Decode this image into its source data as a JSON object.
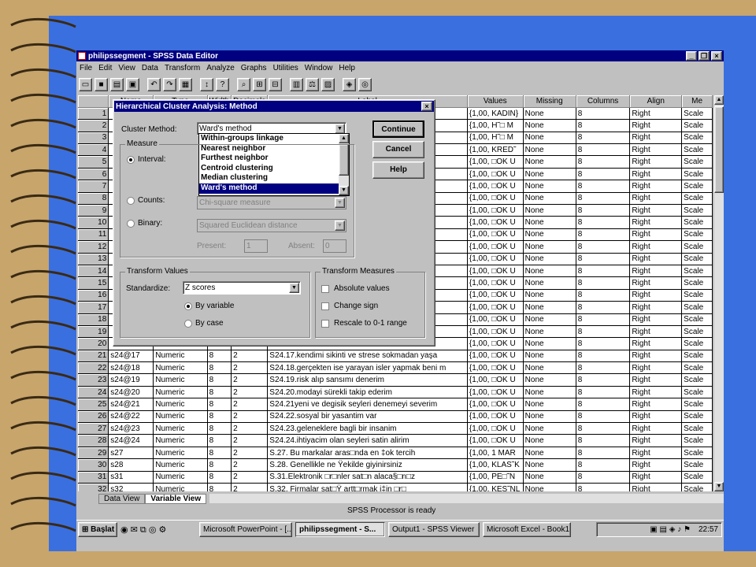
{
  "window": {
    "title": "philipssegment - SPSS Data Editor",
    "menu": [
      "File",
      "Edit",
      "View",
      "Data",
      "Transform",
      "Analyze",
      "Graphs",
      "Utilities",
      "Window",
      "Help"
    ],
    "controls": [
      "_",
      "❐",
      "×"
    ]
  },
  "grid": {
    "columns": [
      "",
      "Name",
      "Type",
      "Width",
      "Decimals",
      "Label",
      "Values",
      "Missing",
      "Columns",
      "Align",
      "Me"
    ],
    "rows": [
      [
        "1",
        "",
        "",
        "",
        "",
        "",
        "{1,00, KADIN}",
        "None",
        "8",
        "Right",
        "Scale"
      ],
      [
        "2",
        "",
        "",
        "",
        "",
        "",
        "{1,00, H˜□ M",
        "None",
        "8",
        "Right",
        "Scale"
      ],
      [
        "3",
        "",
        "",
        "",
        "",
        "",
        "{1,00, H˜□ M",
        "None",
        "8",
        "Right",
        "Scale"
      ],
      [
        "4",
        "",
        "",
        "",
        "",
        "",
        "{1,00, KRED˜",
        "None",
        "8",
        "Right",
        "Scale"
      ],
      [
        "5",
        "",
        "",
        "",
        "",
        "rebil",
        "{1,00, □OK U",
        "None",
        "8",
        "Right",
        "Scale"
      ],
      [
        "6",
        "",
        "",
        "",
        "",
        "",
        "{1,00, □OK U",
        "None",
        "8",
        "Right",
        "Scale"
      ],
      [
        "7",
        "",
        "",
        "",
        "",
        "öne",
        "{1,00, □OK U",
        "None",
        "8",
        "Right",
        "Scale"
      ],
      [
        "8",
        "",
        "",
        "",
        "",
        "",
        "{1,00, □OK U",
        "None",
        "8",
        "Right",
        "Scale"
      ],
      [
        "9",
        "",
        "",
        "",
        "",
        "n",
        "{1,00, □OK U",
        "None",
        "8",
        "Right",
        "Scale"
      ],
      [
        "10",
        "",
        "",
        "",
        "",
        "um",
        "{1,00, □OK U",
        "None",
        "8",
        "Right",
        "Scale"
      ],
      [
        "11",
        "",
        "",
        "",
        "",
        "mel",
        "{1,00, □OK U",
        "None",
        "8",
        "Right",
        "Scale"
      ],
      [
        "12",
        "",
        "",
        "",
        "",
        "n alır",
        "{1,00, □OK U",
        "None",
        "8",
        "Right",
        "Scale"
      ],
      [
        "13",
        "",
        "",
        "",
        "",
        "tirdi",
        "{1,00, □OK U",
        "None",
        "8",
        "Right",
        "Scale"
      ],
      [
        "14",
        "",
        "",
        "",
        "",
        "arm",
        "{1,00, □OK U",
        "None",
        "8",
        "Right",
        "Scale"
      ],
      [
        "15",
        "",
        "",
        "",
        "",
        "edi",
        "{1,00, □OK U",
        "None",
        "8",
        "Right",
        "Scale"
      ],
      [
        "16",
        "",
        "",
        "",
        "",
        "erci",
        "{1,00, □OK U",
        "None",
        "8",
        "Right",
        "Scale"
      ],
      [
        "17",
        "",
        "",
        "",
        "",
        "mak",
        "{1,00, □OK U",
        "None",
        "8",
        "Right",
        "Scale"
      ],
      [
        "18",
        "",
        "",
        "",
        "",
        "",
        "{1,00, □OK U",
        "None",
        "8",
        "Right",
        "Scale"
      ],
      [
        "19",
        "",
        "",
        "",
        "",
        "al b",
        "{1,00, □OK U",
        "None",
        "8",
        "Right",
        "Scale"
      ],
      [
        "20",
        "",
        "",
        "",
        "",
        "",
        "{1,00, □OK U",
        "None",
        "8",
        "Right",
        "Scale"
      ],
      [
        "21",
        "s24@17",
        "Numeric",
        "8",
        "2",
        "S24.17.kendimi sikinti ve strese sokmadan yaşa",
        "{1,00, □OK U",
        "None",
        "8",
        "Right",
        "Scale"
      ],
      [
        "22",
        "s24@18",
        "Numeric",
        "8",
        "2",
        "S24.18.gerçekten ise yarayan isler yapmak beni m",
        "{1,00, □OK U",
        "None",
        "8",
        "Right",
        "Scale"
      ],
      [
        "23",
        "s24@19",
        "Numeric",
        "8",
        "2",
        "S24.19.risk alıp sansımı denerim",
        "{1,00, □OK U",
        "None",
        "8",
        "Right",
        "Scale"
      ],
      [
        "24",
        "s24@20",
        "Numeric",
        "8",
        "2",
        "S24.20.modayi sürekli takip ederim",
        "{1,00, □OK U",
        "None",
        "8",
        "Right",
        "Scale"
      ],
      [
        "25",
        "s24@21",
        "Numeric",
        "8",
        "2",
        "S24.21yeni ve degisik seyleri denemeyi severim",
        "{1,00, □OK U",
        "None",
        "8",
        "Right",
        "Scale"
      ],
      [
        "26",
        "s24@22",
        "Numeric",
        "8",
        "2",
        "S24.22.sosyal bir yasantim var",
        "{1,00, □OK U",
        "None",
        "8",
        "Right",
        "Scale"
      ],
      [
        "27",
        "s24@23",
        "Numeric",
        "8",
        "2",
        "S24.23.geleneklere bagli bir insanim",
        "{1,00, □OK U",
        "None",
        "8",
        "Right",
        "Scale"
      ],
      [
        "28",
        "s24@24",
        "Numeric",
        "8",
        "2",
        "S24.24.ihtiyacim olan seyleri satin alirim",
        "{1,00, □OK U",
        "None",
        "8",
        "Right",
        "Scale"
      ],
      [
        "29",
        "s27",
        "Numeric",
        "8",
        "2",
        "S.27. Bu markalar aras□nda en ‡ok tercih",
        "{1,00, 1 MAR",
        "None",
        "8",
        "Right",
        "Scale"
      ],
      [
        "30",
        "s28",
        "Numeric",
        "8",
        "2",
        "S.28. Genellikle ne Ÿekilde giyinirsiniz",
        "{1,00, KLAS˜K",
        "None",
        "8",
        "Right",
        "Scale"
      ],
      [
        "31",
        "s31",
        "Numeric",
        "8",
        "2",
        "S.31.Elektronik □r□nler sat□n alaca§□n□z",
        "{1,00, PE□˜N",
        "None",
        "8",
        "Right",
        "Scale"
      ],
      [
        "32",
        "s32",
        "Numeric",
        "8",
        "2",
        "S.32. Firmalar sat□Ÿ artt□rmak i‡in  □r□",
        "{1,00, KES˜NL",
        "None",
        "8",
        "Right",
        "Scale"
      ]
    ]
  },
  "tabs": [
    "Data View",
    "Variable View"
  ],
  "status": "SPSS Processor  is ready",
  "taskbar": {
    "start": "Başlat",
    "tasks": [
      "Microsoft PowerPoint - [...",
      "philipssegment - S...",
      "Output1 - SPSS Viewer",
      "Microsoft Excel - Book1"
    ],
    "clock": "22:57"
  },
  "dialog": {
    "title": "Hierarchical Cluster Analysis: Method",
    "cluster_method_label": "Cluster Method:",
    "cluster_method_value": "Ward's method",
    "method_options": [
      "Within-groups linkage",
      "Nearest neighbor",
      "Furthest neighbor",
      "Centroid clustering",
      "Median clustering",
      "Ward's method"
    ],
    "buttons": {
      "continue": "Continue",
      "cancel": "Cancel",
      "help": "Help"
    },
    "measure": {
      "title": "Measure",
      "interval": "Interval:",
      "counts": "Counts:",
      "counts_value": "Chi-square measure",
      "binary": "Binary:",
      "binary_value": "Squared Euclidean distance",
      "present_label": "Present:",
      "present_value": "1",
      "absent_label": "Absent:",
      "absent_value": "0"
    },
    "transform_values": {
      "title": "Transform Values",
      "standardize_label": "Standardize:",
      "standardize_value": "Z scores",
      "by_variable": "By variable",
      "by_case": "By case"
    },
    "transform_measures": {
      "title": "Transform Measures",
      "absolute": "Absolute values",
      "change_sign": "Change sign",
      "rescale": "Rescale to 0-1 range"
    }
  }
}
